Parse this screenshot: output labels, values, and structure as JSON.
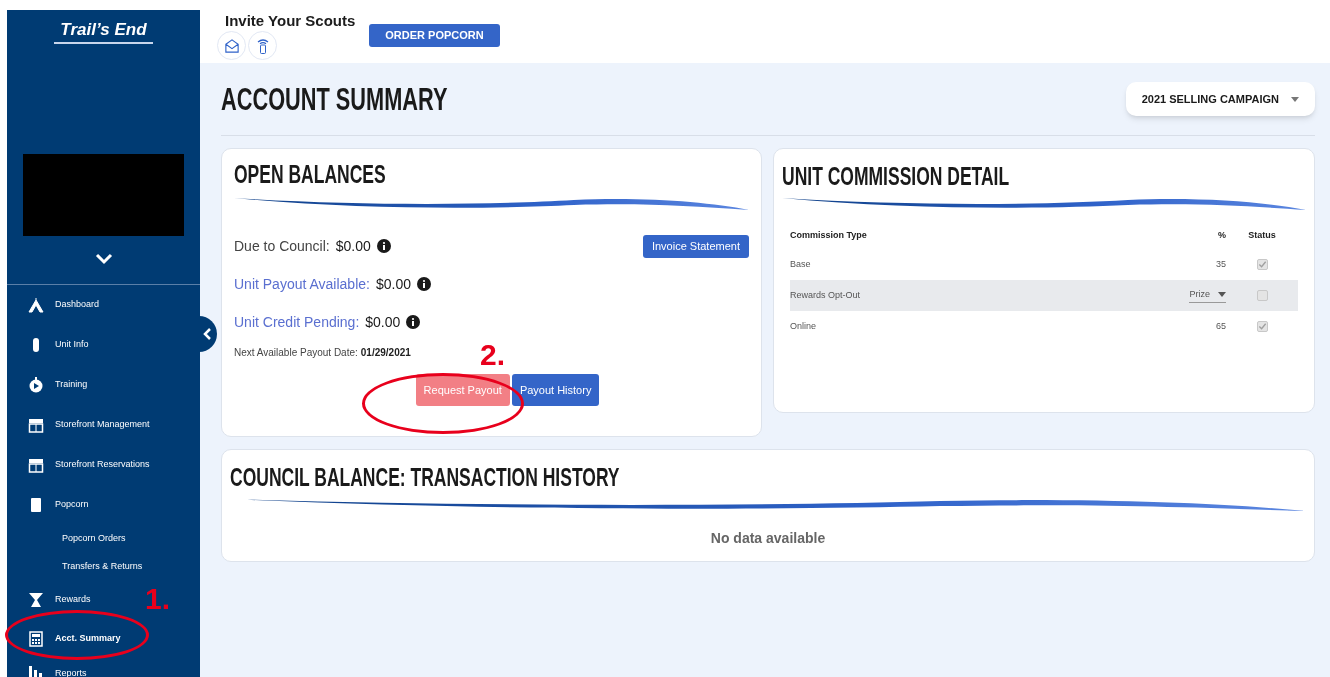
{
  "sidebar": {
    "logo": "Trail’s End",
    "items": [
      {
        "label": "Dashboard",
        "kind": "main",
        "selected": false
      },
      {
        "label": "Unit Info",
        "kind": "main",
        "selected": false
      },
      {
        "label": "Training",
        "kind": "main",
        "selected": false
      },
      {
        "label": "Storefront Management",
        "kind": "main",
        "selected": false
      },
      {
        "label": "Storefront Reservations",
        "kind": "main",
        "selected": false
      },
      {
        "label": "Popcorn",
        "kind": "main",
        "selected": false
      },
      {
        "label": "Popcorn Orders",
        "kind": "sub",
        "selected": false
      },
      {
        "label": "Transfers & Returns",
        "kind": "sub",
        "selected": false
      },
      {
        "label": "Rewards",
        "kind": "main",
        "selected": false
      },
      {
        "label": "Acct. Summary",
        "kind": "main",
        "selected": true
      },
      {
        "label": "Reports",
        "kind": "main",
        "selected": false
      }
    ]
  },
  "header": {
    "title": "Invite Your Scouts",
    "order_button": "ORDER POPCORN"
  },
  "page": {
    "title": "ACCOUNT SUMMARY",
    "campaign": "2021 SELLING CAMPAIGN"
  },
  "open_balances": {
    "title": "OPEN BALANCES",
    "invoice_button": "Invoice Statement",
    "rows": [
      {
        "label": "Due to Council:",
        "value": "$0.00",
        "kind": "plain"
      },
      {
        "label": "Unit Payout Available:",
        "value": "$0.00",
        "kind": "link"
      },
      {
        "label": "Unit Credit Pending:",
        "value": "$0.00",
        "kind": "link"
      }
    ],
    "next_payout": {
      "label": "Next Available Payout Date:",
      "value": "01/29/2021"
    },
    "buttons": [
      {
        "label": "Request Payout",
        "disabled": true
      },
      {
        "label": "Payout History",
        "disabled": false
      }
    ]
  },
  "commission": {
    "title": "UNIT COMMISSION DETAIL",
    "columns": [
      "Commission Type",
      "%",
      "Status"
    ],
    "rows": [
      {
        "type": "Base",
        "percent": "35",
        "kind": "value",
        "checked": true,
        "highlighted": false
      },
      {
        "type": "Rewards Opt-Out",
        "percent": "Prize",
        "kind": "select",
        "checked": false,
        "highlighted": true
      },
      {
        "type": "Online",
        "percent": "65",
        "kind": "value",
        "checked": true,
        "highlighted": false
      }
    ]
  },
  "transactions": {
    "title": "COUNCIL BALANCE: TRANSACTION HISTORY",
    "empty": "No data available"
  },
  "annotations": [
    {
      "label": "1."
    },
    {
      "label": "2."
    }
  ]
}
